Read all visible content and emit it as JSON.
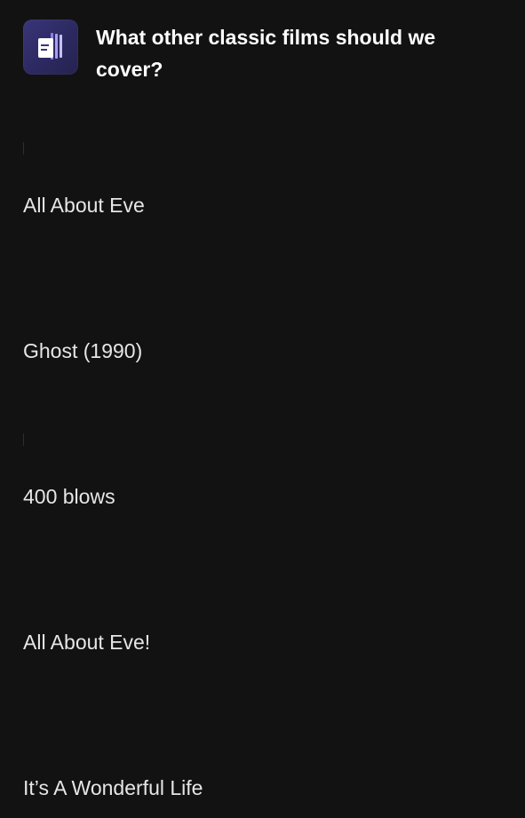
{
  "header": {
    "icon": "podcast-stack-icon",
    "question": "What other classic films should we cover?"
  },
  "answers": [
    {
      "text": "All About Eve"
    },
    {
      "text": "Ghost (1990)"
    },
    {
      "text": "400 blows"
    },
    {
      "text": "All About Eve!"
    },
    {
      "text": "It’s A Wonderful Life"
    }
  ],
  "colors": {
    "background": "#121212",
    "question_text": "#ffffff",
    "answer_text": "#e6e6e6",
    "icon_background": "#2c2961",
    "icon_accent": "#7b6fe0"
  }
}
